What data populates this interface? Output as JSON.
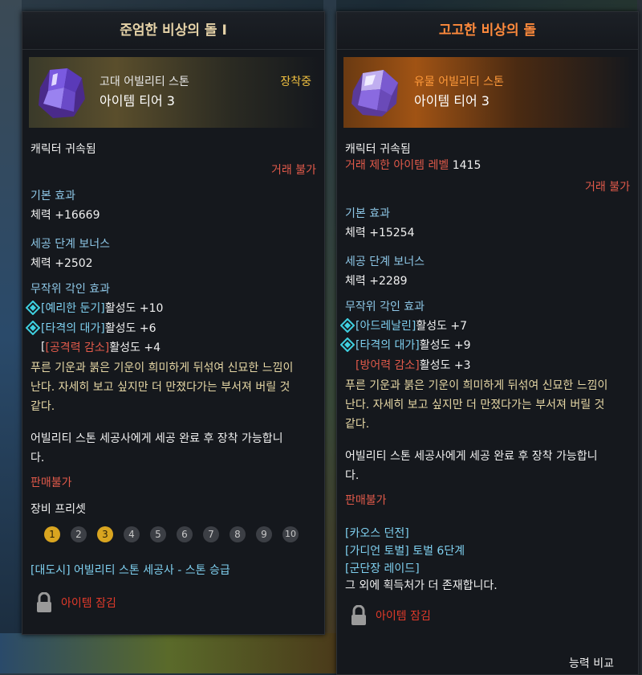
{
  "left": {
    "title": "준엄한 비상의 돌 I",
    "grade": "고대 어빌리티 스톤",
    "tier": "아이템 티어 3",
    "equipped": "장착중",
    "bound": "캐릭터 귀속됨",
    "trade": "거래 불가",
    "base_header": "기본 효과",
    "base_value": "체력 +16669",
    "bonus_header": "세공 단계 보너스",
    "bonus_value": "체력 +2502",
    "engrave_header": "무작위 각인 효과",
    "engravings": [
      {
        "name": "[예리한 둔기]",
        "effect": " 활성도 +10",
        "negative": false
      },
      {
        "name": "[타격의 대가]",
        "effect": " 활성도 +6",
        "negative": false
      },
      {
        "name": "[공격력 감소]",
        "effect": " 활성도 +4",
        "negative": true
      }
    ],
    "desc": [
      "푸른 기운과 붉은 기운이 희미하게 뒤섞여 신묘한 느낌이",
      "난다. 자세히 보고 싶지만 더 만졌다가는 부서져 버릴 것",
      "같다."
    ],
    "equip_note": [
      "어빌리티 스톤 세공사에게 세공 완료 후 장착 가능합니",
      "다."
    ],
    "not_for_sale": "판매불가",
    "preset_header": "장비 프리셋",
    "presets": [
      "1",
      "2",
      "3",
      "4",
      "5",
      "6",
      "7",
      "8",
      "9",
      "10"
    ],
    "preset_active": [
      "1",
      "3"
    ],
    "npc_link": "[대도시] 어빌리티 스톤 세공사 - 스톤 승급",
    "lock_label": "아이템 잠김"
  },
  "right": {
    "title": "고고한 비상의 돌",
    "grade": "유물 어빌리티 스톤",
    "tier": "아이템 티어 3",
    "bound": "캐릭터 귀속됨",
    "level_req_label": "거래 제한 아이템 레벨",
    "level_req_value": "1415",
    "trade": "거래 불가",
    "base_header": "기본 효과",
    "base_value": "체력 +15254",
    "bonus_header": "세공 단계 보너스",
    "bonus_value": "체력 +2289",
    "engrave_header": "무작위 각인 효과",
    "engravings": [
      {
        "name": "[아드레날린]",
        "effect": " 활성도 +7",
        "negative": false
      },
      {
        "name": "[타격의 대가]",
        "effect": " 활성도 +9",
        "negative": false
      },
      {
        "name": "[방어력 감소]",
        "effect": " 활성도 +3",
        "negative": true
      }
    ],
    "desc": [
      "푸른 기운과 붉은 기운이 희미하게 뒤섞여 신묘한 느낌이",
      "난다. 자세히 보고 싶지만 더 만졌다가는 부서져 버릴 것",
      "같다."
    ],
    "equip_note": [
      "어빌리티 스톤 세공사에게 세공 완료 후 장착 가능합니",
      "다."
    ],
    "not_for_sale": "판매불가",
    "sources": [
      "[카오스 던전]",
      "[가디언 토벌] 토벌 6단계",
      "[군단장 레이드]"
    ],
    "sources_more": "그 외에 획득처가 더 존재합니다.",
    "lock_label": "아이템 잠김",
    "compare_label": "능력 비교"
  },
  "colors": {
    "header_blue": "#8ec8e8",
    "trade_red": "#e25a4a",
    "desc_gold": "#e6d7a5",
    "equipped_gold": "#f0c040",
    "relic_orange": "#ff8a3c",
    "preset_active": "#d9a520"
  },
  "icons": {
    "stone": "ability-stone-icon",
    "engraving": "engraving-diamond-icon",
    "lock": "padlock-icon"
  }
}
